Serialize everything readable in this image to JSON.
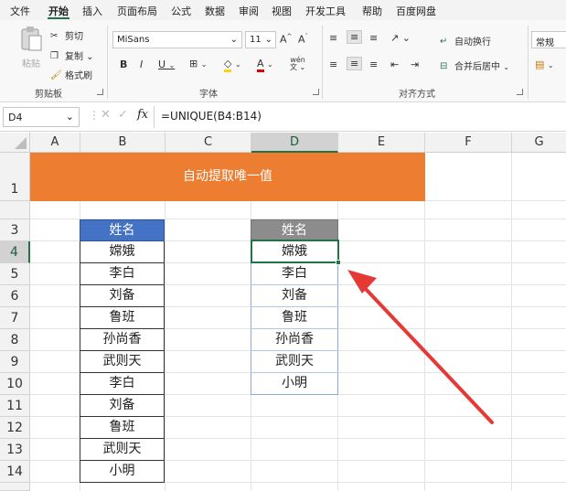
{
  "menu": [
    "文件",
    "开始",
    "插入",
    "页面布局",
    "公式",
    "数据",
    "审阅",
    "视图",
    "开发工具",
    "帮助",
    "百度网盘"
  ],
  "ribbon": {
    "clipboard": {
      "paste": "粘贴",
      "cut": "剪切",
      "copy": "复制",
      "format_painter": "格式刷",
      "label": "剪贴板"
    },
    "font": {
      "name": "MiSans",
      "size": "11",
      "label": "字体",
      "wen": "wén"
    },
    "alignment": {
      "wrap": "自动换行",
      "merge": "合并后居中",
      "label": "对齐方式"
    },
    "number": {
      "format": "常规"
    }
  },
  "formula_bar": {
    "cell": "D4",
    "formula": "=UNIQUE(B4:B14)",
    "fx": "fx"
  },
  "columns": [
    "A",
    "B",
    "C",
    "D",
    "E",
    "F",
    "G"
  ],
  "rows": [
    "1",
    "3",
    "4",
    "5",
    "6",
    "7",
    "8",
    "9",
    "10",
    "11",
    "12",
    "13",
    "14"
  ],
  "banner": "自动提取唯一值",
  "source": {
    "header": "姓名",
    "values": [
      "嫦娥",
      "李白",
      "刘备",
      "鲁班",
      "孙尚香",
      "武则天",
      "李白",
      "刘备",
      "鲁班",
      "武则天",
      "小明"
    ]
  },
  "result": {
    "header": "姓名",
    "values": [
      "嫦娥",
      "李白",
      "刘备",
      "鲁班",
      "孙尚香",
      "武则天",
      "小明"
    ]
  },
  "colors": {
    "banner": "#ed7d31",
    "source_header": "#4472c4",
    "result_header": "#8c8c8c",
    "arrow": "#e53935",
    "excel_green": "#217346"
  }
}
